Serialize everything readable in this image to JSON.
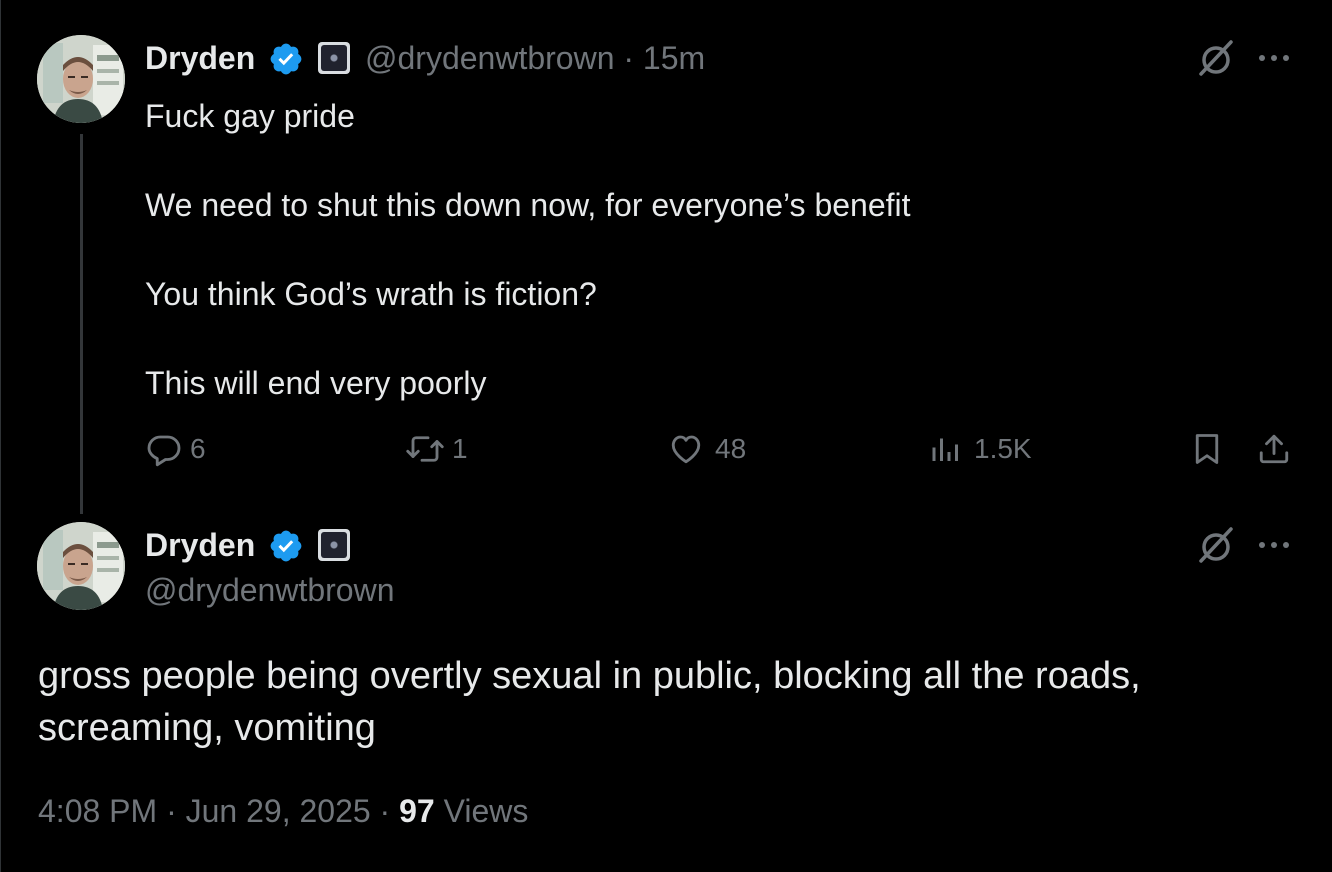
{
  "colors": {
    "background": "#000000",
    "text_primary": "#e7e9ea",
    "text_secondary": "#71767b",
    "verified_blue": "#1d9bf0",
    "thread_line": "#333639"
  },
  "parent_tweet": {
    "author_name": "Dryden",
    "handle": "@drydenwtbrown",
    "separator": "·",
    "time_ago": "15m",
    "lines": [
      "Fuck gay pride",
      "",
      "We need to shut this down now, for everyone’s benefit",
      "",
      "You think God’s wrath is fiction?",
      "",
      "This will end very poorly"
    ],
    "actions": {
      "replies": "6",
      "reposts": "1",
      "likes": "48",
      "views": "1.5K"
    },
    "icons": [
      "verified-badge-icon",
      "affiliate-badge-icon",
      "grok-icon",
      "more-icon",
      "reply-icon",
      "repost-icon",
      "like-icon",
      "views-icon",
      "bookmark-icon",
      "share-icon"
    ]
  },
  "main_tweet": {
    "author_name": "Dryden",
    "handle": "@drydenwtbrown",
    "text": "gross people being overtly sexual in public, blocking all the roads, screaming, vomiting",
    "time": "4:08 PM",
    "sep1": "·",
    "date": "Jun 29, 2025",
    "sep2": "·",
    "views_count": "97",
    "views_label": "Views"
  }
}
